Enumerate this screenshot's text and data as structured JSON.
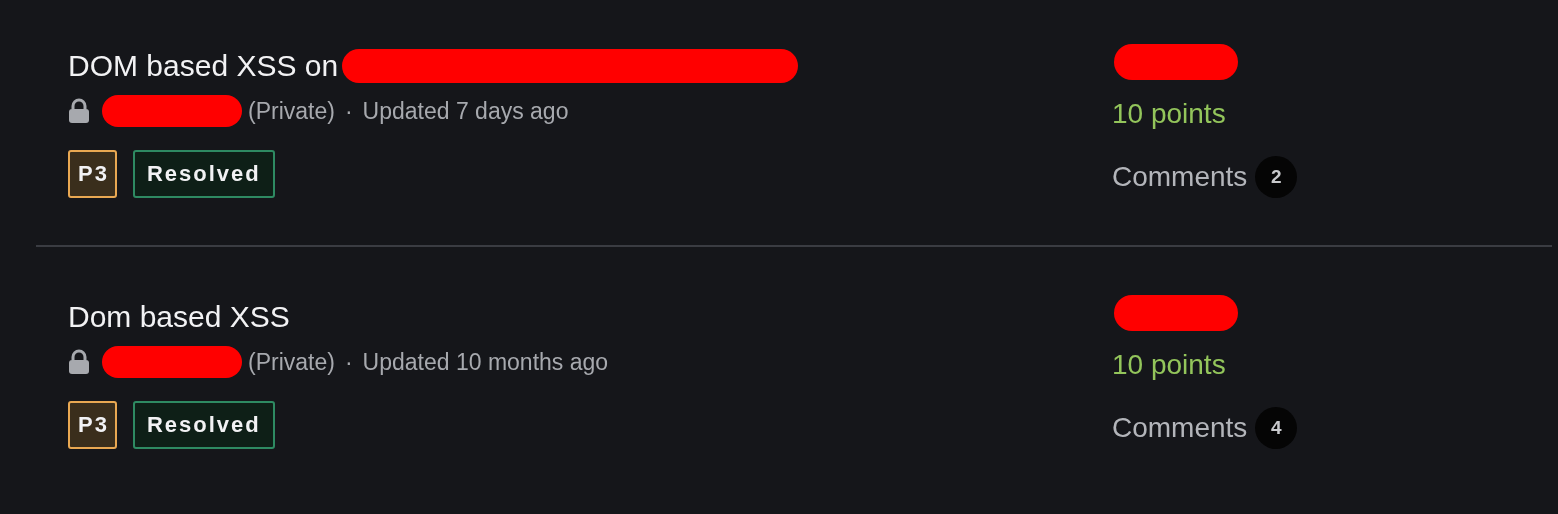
{
  "reports": [
    {
      "title": "DOM based XSS on",
      "title_redacted": true,
      "visibility": "(Private)",
      "separator": "·",
      "updated": "Updated 7 days ago",
      "severity": "P3",
      "status": "Resolved",
      "points": "10 points",
      "comments_label": "Comments",
      "comments_count": "2"
    },
    {
      "title": "Dom based XSS",
      "title_redacted": false,
      "visibility": "(Private)",
      "separator": "·",
      "updated": "Updated 10 months ago",
      "severity": "P3",
      "status": "Resolved",
      "points": "10 points",
      "comments_label": "Comments",
      "comments_count": "4"
    }
  ]
}
